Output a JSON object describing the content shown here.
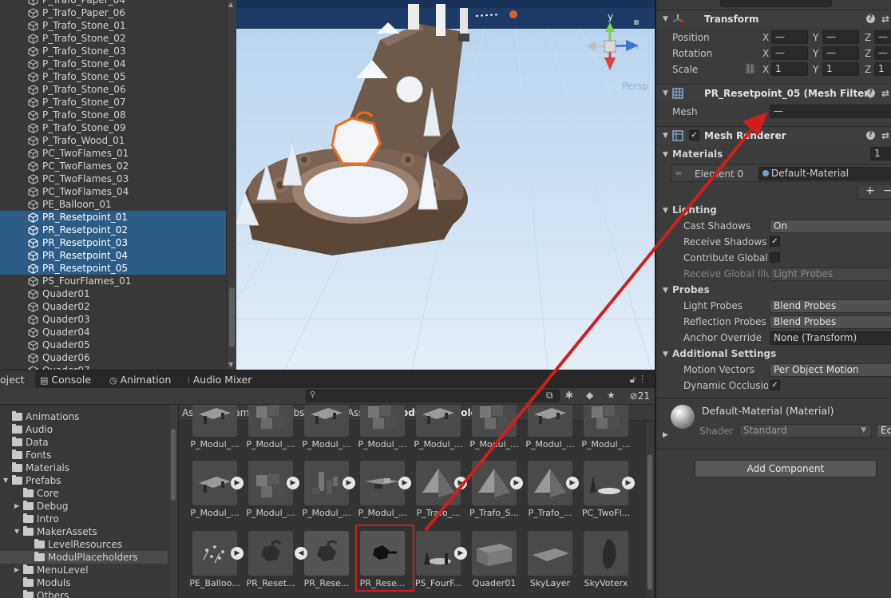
{
  "hierarchy": {
    "items": [
      {
        "name": "P_Trafo_Paper_04",
        "selected": false
      },
      {
        "name": "P_Trafo_Paper_06",
        "selected": false
      },
      {
        "name": "P_Trafo_Stone_01",
        "selected": false
      },
      {
        "name": "P_Trafo_Stone_02",
        "selected": false
      },
      {
        "name": "P_Trafo_Stone_03",
        "selected": false
      },
      {
        "name": "P_Trafo_Stone_04",
        "selected": false
      },
      {
        "name": "P_Trafo_Stone_05",
        "selected": false
      },
      {
        "name": "P_Trafo_Stone_06",
        "selected": false
      },
      {
        "name": "P_Trafo_Stone_07",
        "selected": false
      },
      {
        "name": "P_Trafo_Stone_08",
        "selected": false
      },
      {
        "name": "P_Trafo_Stone_09",
        "selected": false
      },
      {
        "name": "P_Trafo_Wood_01",
        "selected": false
      },
      {
        "name": "PC_TwoFlames_01",
        "selected": false
      },
      {
        "name": "PC_TwoFlames_02",
        "selected": false
      },
      {
        "name": "PC_TwoFlames_03",
        "selected": false
      },
      {
        "name": "PC_TwoFlames_04",
        "selected": false
      },
      {
        "name": "PE_Balloon_01",
        "selected": false
      },
      {
        "name": "PR_Resetpoint_01",
        "selected": true
      },
      {
        "name": "PR_Resetpoint_02",
        "selected": true
      },
      {
        "name": "PR_Resetpoint_03",
        "selected": true
      },
      {
        "name": "PR_Resetpoint_04",
        "selected": true
      },
      {
        "name": "PR_Resetpoint_05",
        "selected": true
      },
      {
        "name": "PS_FourFlames_01",
        "selected": false
      },
      {
        "name": "Quader01",
        "selected": false
      },
      {
        "name": "Quader02",
        "selected": false
      },
      {
        "name": "Quader03",
        "selected": false
      },
      {
        "name": "Quader04",
        "selected": false
      },
      {
        "name": "Quader05",
        "selected": false
      },
      {
        "name": "Quader06",
        "selected": false
      },
      {
        "name": "Quader07",
        "selected": false
      }
    ]
  },
  "scene": {
    "gizmo_axis_label": "y",
    "projection_label": "Persp"
  },
  "inspector": {
    "transform": {
      "title": "Transform",
      "position_label": "Position",
      "rotation_label": "Rotation",
      "scale_label": "Scale",
      "x": "X",
      "y": "Y",
      "z": "Z",
      "position": {
        "x": "—",
        "y": "—",
        "z": "—"
      },
      "rotation": {
        "x": "—",
        "y": "—",
        "z": "—"
      },
      "scale": {
        "x": "1",
        "y": "1",
        "z": "1"
      }
    },
    "mesh_filter": {
      "title": "PR_Resetpoint_05 (Mesh Filter)",
      "mesh_label": "Mesh",
      "mesh_value": "—"
    },
    "mesh_renderer": {
      "title": "Mesh Renderer",
      "enabled": true,
      "materials_label": "Materials",
      "materials_count": "1",
      "element0_label": "Element 0",
      "element0_value": "Default-Material",
      "add_btn": "+",
      "remove_btn": "−",
      "lighting_label": "Lighting",
      "cast_shadows_label": "Cast Shadows",
      "cast_shadows_value": "On",
      "receive_shadows_label": "Receive Shadows",
      "receive_shadows": true,
      "contribute_gi_label": "Contribute Global I",
      "contribute_gi": false,
      "receive_gi_label": "Receive Global Illu",
      "receive_gi_value": "Light Probes",
      "probes_label": "Probes",
      "light_probes_label": "Light Probes",
      "light_probes_value": "Blend Probes",
      "reflection_probes_label": "Reflection Probes",
      "reflection_probes_value": "Blend Probes",
      "anchor_override_label": "Anchor Override",
      "anchor_override_value": "None (Transform)",
      "additional_label": "Additional Settings",
      "motion_vectors_label": "Motion Vectors",
      "motion_vectors_value": "Per Object Motion",
      "dynamic_occlusion_label": "Dynamic Occlusion",
      "dynamic_occlusion": true
    },
    "material": {
      "name": "Default-Material (Material)",
      "shader_label": "Shader",
      "shader_value": "Standard",
      "edit_label": "Ed"
    },
    "add_component": "Add Component"
  },
  "project": {
    "tabs": [
      {
        "label": "oject",
        "icon": "folder-icon",
        "active": true
      },
      {
        "label": "Console",
        "icon": "console-icon",
        "active": false
      },
      {
        "label": "Animation",
        "icon": "animation-icon",
        "active": false
      },
      {
        "label": "Audio Mixer",
        "icon": "audio-mixer-icon",
        "active": false
      }
    ],
    "hidden_count": "21",
    "folders": [
      {
        "name": "Animations",
        "indent": 0,
        "expand": "",
        "selected": false
      },
      {
        "name": "Audio",
        "indent": 0,
        "expand": "",
        "selected": false
      },
      {
        "name": "Data",
        "indent": 0,
        "expand": "",
        "selected": false
      },
      {
        "name": "Fonts",
        "indent": 0,
        "expand": "",
        "selected": false
      },
      {
        "name": "Materials",
        "indent": 0,
        "expand": "",
        "selected": false
      },
      {
        "name": "Prefabs",
        "indent": 0,
        "expand": "open",
        "selected": false
      },
      {
        "name": "Core",
        "indent": 1,
        "expand": "",
        "selected": false
      },
      {
        "name": "Debug",
        "indent": 1,
        "expand": "closed",
        "selected": false
      },
      {
        "name": "Intro",
        "indent": 1,
        "expand": "",
        "selected": false
      },
      {
        "name": "MakerAssets",
        "indent": 1,
        "expand": "open",
        "selected": false
      },
      {
        "name": "LevelResources",
        "indent": 2,
        "expand": "",
        "selected": false
      },
      {
        "name": "ModulPlaceholders",
        "indent": 2,
        "expand": "",
        "selected": true
      },
      {
        "name": "MenuLevel",
        "indent": 1,
        "expand": "closed",
        "selected": false
      },
      {
        "name": "Moduls",
        "indent": 1,
        "expand": "",
        "selected": false
      },
      {
        "name": "Others",
        "indent": 1,
        "expand": "",
        "selected": false
      }
    ],
    "breadcrumb": [
      "Assets",
      "Game",
      "Prefabs",
      "MakerAssets",
      "ModulPlaceholders"
    ],
    "row1_labels": [
      "P_Modul_...",
      "P_Modul_...",
      "P_Modul_...",
      "P_Modul_...",
      "P_Modul_...",
      "P_Modul_...",
      "P_Modul_...",
      "P_Modul_..."
    ],
    "row2": [
      {
        "label": "P_Modul_...",
        "play": true,
        "thumb": "flat"
      },
      {
        "label": "P_Modul_...",
        "play": true,
        "thumb": "cubes"
      },
      {
        "label": "P_Modul_...",
        "play": true,
        "thumb": "blocks"
      },
      {
        "label": "P_Modul_...",
        "play": true,
        "thumb": "plane"
      },
      {
        "label": "P_Trafo_...",
        "play": true,
        "thumb": "pyramid"
      },
      {
        "label": "P_Trafo_S...",
        "play": true,
        "thumb": "pyramid"
      },
      {
        "label": "P_Trafo_...",
        "play": true,
        "thumb": "pyramid"
      },
      {
        "label": "PC_TwoFl...",
        "play": true,
        "thumb": "cone"
      }
    ],
    "row3": [
      {
        "label": "PE_Balloo...",
        "thumb": "balloon"
      },
      {
        "label": "PR_Reset...",
        "thumb": "hex"
      },
      {
        "label": "PR_Rese...",
        "thumb": "hex"
      },
      {
        "label": "PR_Rese...",
        "thumb": "hexdark"
      },
      {
        "label": "PS_FourF...",
        "thumb": "four"
      },
      {
        "label": "Quader01",
        "thumb": "box"
      },
      {
        "label": "SkyLayer",
        "thumb": "sky"
      },
      {
        "label": "SkyVoterx",
        "thumb": "vortex"
      }
    ]
  },
  "colors": {
    "selection": "#2c5d87",
    "annotation_red": "#d01e1e",
    "sky": "#cfe3f5"
  }
}
